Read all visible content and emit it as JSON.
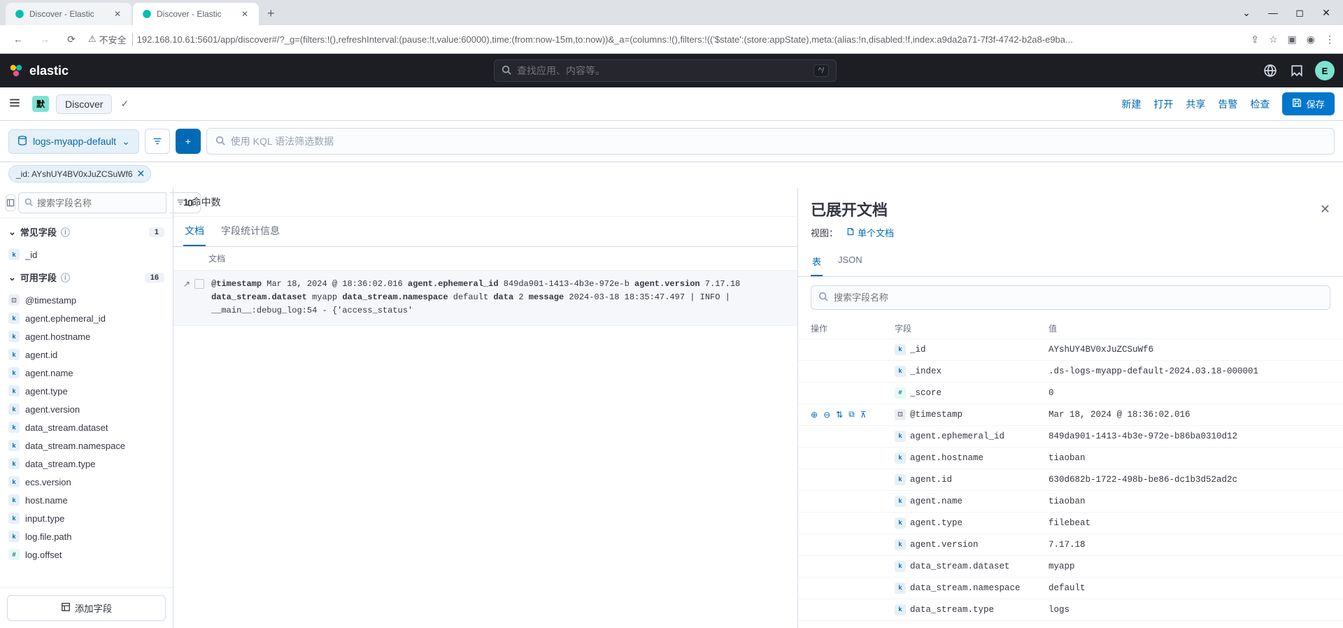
{
  "browser": {
    "tabs": [
      {
        "title": "Discover - Elastic",
        "active": false
      },
      {
        "title": "Discover - Elastic",
        "active": true
      }
    ],
    "insecure_label": "不安全",
    "url": "192.168.10.61:5601/app/discover#/?_g=(filters:!(),refreshInterval:(pause:!t,value:60000),time:(from:now-15m,to:now))&_a=(columns:!(),filters:!(('$state':(store:appState),meta:(alias:!n,disabled:!f,index:a9da2a71-7f3f-4742-b2a8-e9ba..."
  },
  "header": {
    "logo": "elastic",
    "search_placeholder": "查找应用、内容等。",
    "kbd": "^/",
    "avatar": "E"
  },
  "toolbar": {
    "space": "默",
    "discover": "Discover",
    "links": {
      "new": "新建",
      "open": "打开",
      "share": "共享",
      "alert": "告警",
      "inspect": "检查"
    },
    "save": "保存"
  },
  "filter": {
    "dataview": "logs-myapp-default",
    "kql_placeholder": "使用 KQL 语法筛选数据",
    "pill_label": "_id: AYshUY4BV0xJuZCSuWf6"
  },
  "sidebar": {
    "search_placeholder": "搜索字段名称",
    "filter_count": "0",
    "selected": {
      "label": "常见字段",
      "count": "1",
      "items": [
        {
          "type": "k",
          "name": "_id"
        }
      ]
    },
    "available": {
      "label": "可用字段",
      "count": "16",
      "items": [
        {
          "type": "d",
          "name": "@timestamp"
        },
        {
          "type": "k",
          "name": "agent.ephemeral_id"
        },
        {
          "type": "k",
          "name": "agent.hostname"
        },
        {
          "type": "k",
          "name": "agent.id"
        },
        {
          "type": "k",
          "name": "agent.name"
        },
        {
          "type": "k",
          "name": "agent.type"
        },
        {
          "type": "k",
          "name": "agent.version"
        },
        {
          "type": "k",
          "name": "data_stream.dataset"
        },
        {
          "type": "k",
          "name": "data_stream.namespace"
        },
        {
          "type": "k",
          "name": "data_stream.type"
        },
        {
          "type": "k",
          "name": "ecs.version"
        },
        {
          "type": "k",
          "name": "host.name"
        },
        {
          "type": "k",
          "name": "input.type"
        },
        {
          "type": "k",
          "name": "log.file.path"
        },
        {
          "type": "n",
          "name": "log.offset"
        }
      ]
    },
    "add_field": "添加字段"
  },
  "docs": {
    "hits_count": "1",
    "hits_label": "命中数",
    "tabs": {
      "doc": "文档",
      "stats": "字段统计信息"
    },
    "col": "文档",
    "row_html": "<b>@timestamp</b> Mar 18, 2024 @ 18:36:02.016 <b>agent.ephemeral_id</b> 849da901-1413-4b3e-972e-b <b>agent.version</b> 7.17.18 <b>data_stream.dataset</b> myapp <b>data_stream.namespace</b> default <b>data</b> 2 <b>message</b> 2024-03-18 18:35:47.497 | INFO | __main__:debug_log:54 - {'access_status'"
  },
  "flyout": {
    "title": "已展开文档",
    "view_label": "视图：",
    "single_doc": "单个文档",
    "tabs": {
      "table": "表",
      "json": "JSON"
    },
    "search_placeholder": "搜索字段名称",
    "headers": {
      "actions": "操作",
      "field": "字段",
      "value": "值"
    },
    "rows": [
      {
        "type": "k",
        "field": "_id",
        "value": "AYshUY4BV0xJuZCSuWf6"
      },
      {
        "type": "k",
        "field": "_index",
        "value": ".ds-logs-myapp-default-2024.03.18-000001"
      },
      {
        "type": "n",
        "field": "_score",
        "value": "0"
      },
      {
        "type": "d",
        "field": "@timestamp",
        "value": "Mar 18, 2024 @ 18:36:02.016",
        "hovered": true
      },
      {
        "type": "k",
        "field": "agent.ephemeral_id",
        "value": "849da901-1413-4b3e-972e-b86ba0310d12"
      },
      {
        "type": "k",
        "field": "agent.hostname",
        "value": "tiaoban"
      },
      {
        "type": "k",
        "field": "agent.id",
        "value": "630d682b-1722-498b-be86-dc1b3d52ad2c"
      },
      {
        "type": "k",
        "field": "agent.name",
        "value": "tiaoban"
      },
      {
        "type": "k",
        "field": "agent.type",
        "value": "filebeat"
      },
      {
        "type": "k",
        "field": "agent.version",
        "value": "7.17.18"
      },
      {
        "type": "k",
        "field": "data_stream.dataset",
        "value": "myapp"
      },
      {
        "type": "k",
        "field": "data_stream.namespace",
        "value": "default"
      },
      {
        "type": "k",
        "field": "data_stream.type",
        "value": "logs"
      }
    ]
  }
}
